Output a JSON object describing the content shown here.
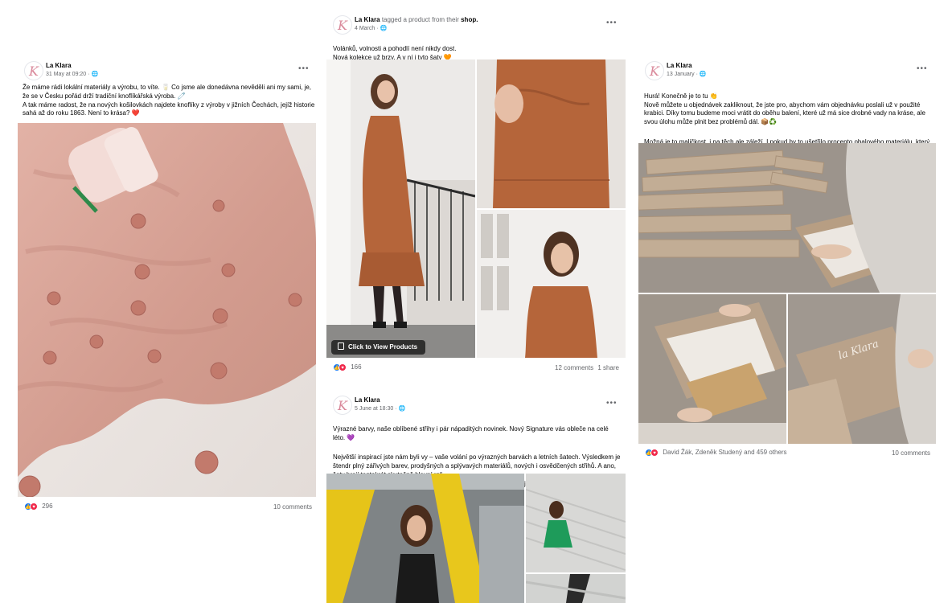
{
  "posts": {
    "left": {
      "author": "La Klara",
      "date": "31 May at 09:20",
      "text": [
        "Že máme rádi lokální materiály a výrobu, to víte. 🥛 Co jsme ale donedávna nevěděli ani my sami, je, že se v Česku pořád drží tradiční knoflíkářská výroba. 🧷",
        "A tak máme radost, že na nových košilovkách najdete knoflíky z výroby v jižních Čechách, jejíž historie sahá až do roku 1863. Není to krása? ❤️"
      ],
      "reaction_count": "296",
      "comments": "10 comments"
    },
    "middle_top": {
      "author": "La Klara",
      "tagged_text": "tagged a product from their",
      "tagged_shop": "shop.",
      "date": "4 March",
      "text": [
        "Volánků, volnosti a pohodlí není nikdy dost.\nNová kolekce už brzy. A v ní i tyto šaty 🧡"
      ],
      "cta_label": "Click to View Products",
      "reaction_count": "166",
      "comments": "12 comments",
      "shares": "1 share"
    },
    "middle_bottom": {
      "author": "La Klara",
      "date": "5 June at 18:30",
      "text": [
        "Výrazné barvy, naše oblíbené střihy i pár nápaditých novinek. Nový Signature vás obleče na celé léto. 💜",
        "Největší inspirací jste nám byli vy – vaše volání po výrazných barvách a letních šatech. Výsledkem je štendr plný zářivých barev, prodyšných a splývavých materiálů, nových i osvědčených střihů. A ano, šaty hrají tentokrát skutečně hlavní roli.\nNěkteré kousky jsou aktuálně vyprodané, ale nebojte. Už teď pracujeme na jejich doplnění."
      ]
    },
    "right": {
      "author": "La Klara",
      "date": "13 January",
      "text": [
        "Hurá! Konečně je to tu 👏\nNově můžete u objednávek zakliknout, že jste pro, abychom vám objednávku poslali už v použité krabici. Díky tomu budeme moci vrátit do oběhu balení, které už má sice drobné vady na kráse, ale svou úlohu může plnit bez problémů dál. 📦♻️",
        "Možná je to maličkost, i na těch ale záleží. I pokud by to ušetřilo procento obalového materiálu, který je v oběhu, má to podle nás smysl. 💚"
      ],
      "reactors": "David Žák, Zdeněk Studený and 459 others",
      "comments": "10 comments",
      "box_logo": "la Klara"
    }
  },
  "avatar_letter": "K",
  "globe_icon": "🌐",
  "more_icon": "•••",
  "colors": {
    "like": "#1877f2",
    "love": "#f0284a",
    "secondary_text": "#65676b",
    "dress": "#b5653a",
    "blush_fabric": "#d9a599",
    "box_kraft": "#b9a28a",
    "green_dress": "#1e9b5a"
  }
}
